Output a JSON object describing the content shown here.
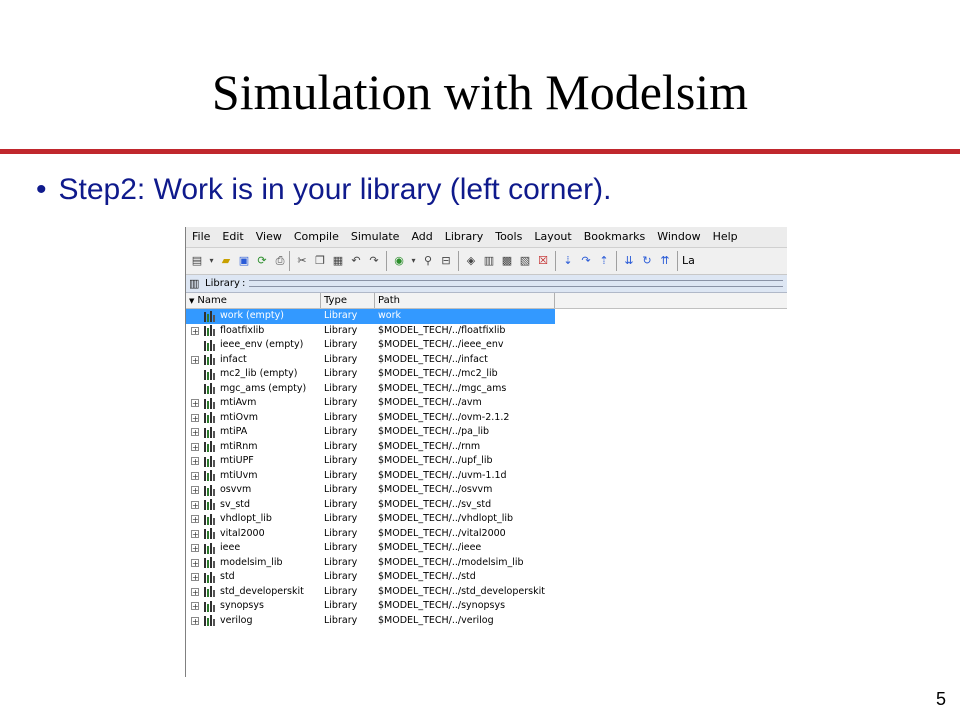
{
  "slide": {
    "title": "Simulation with Modelsim",
    "bullet": "Step2: Work is in your library (left corner).",
    "bullet_marker": "•",
    "page_number": "5",
    "accent_color": "#c0272d",
    "bullet_color": "#0f1a8c"
  },
  "app": {
    "menu": [
      "File",
      "Edit",
      "View",
      "Compile",
      "Simulate",
      "Add",
      "Library",
      "Tools",
      "Layout",
      "Bookmarks",
      "Window",
      "Help"
    ],
    "toolbar_cut_text": "La",
    "panel": {
      "title": "Library",
      "icon": "library-icon"
    },
    "columns": {
      "name": "Name",
      "type": "Type",
      "path": "Path"
    },
    "selection_color": "#3399ff",
    "libraries": [
      {
        "name": "work  (empty)",
        "type": "Library",
        "path": "work",
        "expandable": false,
        "selected": true
      },
      {
        "name": "floatfixlib",
        "type": "Library",
        "path": "$MODEL_TECH/../floatfixlib",
        "expandable": true
      },
      {
        "name": "ieee_env  (empty)",
        "type": "Library",
        "path": "$MODEL_TECH/../ieee_env",
        "expandable": false
      },
      {
        "name": "infact",
        "type": "Library",
        "path": "$MODEL_TECH/../infact",
        "expandable": true
      },
      {
        "name": "mc2_lib  (empty)",
        "type": "Library",
        "path": "$MODEL_TECH/../mc2_lib",
        "expandable": false
      },
      {
        "name": "mgc_ams  (empty)",
        "type": "Library",
        "path": "$MODEL_TECH/../mgc_ams",
        "expandable": false
      },
      {
        "name": "mtiAvm",
        "type": "Library",
        "path": "$MODEL_TECH/../avm",
        "expandable": true
      },
      {
        "name": "mtiOvm",
        "type": "Library",
        "path": "$MODEL_TECH/../ovm-2.1.2",
        "expandable": true
      },
      {
        "name": "mtiPA",
        "type": "Library",
        "path": "$MODEL_TECH/../pa_lib",
        "expandable": true
      },
      {
        "name": "mtiRnm",
        "type": "Library",
        "path": "$MODEL_TECH/../rnm",
        "expandable": true
      },
      {
        "name": "mtiUPF",
        "type": "Library",
        "path": "$MODEL_TECH/../upf_lib",
        "expandable": true
      },
      {
        "name": "mtiUvm",
        "type": "Library",
        "path": "$MODEL_TECH/../uvm-1.1d",
        "expandable": true
      },
      {
        "name": "osvvm",
        "type": "Library",
        "path": "$MODEL_TECH/../osvvm",
        "expandable": true
      },
      {
        "name": "sv_std",
        "type": "Library",
        "path": "$MODEL_TECH/../sv_std",
        "expandable": true
      },
      {
        "name": "vhdlopt_lib",
        "type": "Library",
        "path": "$MODEL_TECH/../vhdlopt_lib",
        "expandable": true
      },
      {
        "name": "vital2000",
        "type": "Library",
        "path": "$MODEL_TECH/../vital2000",
        "expandable": true
      },
      {
        "name": "ieee",
        "type": "Library",
        "path": "$MODEL_TECH/../ieee",
        "expandable": true
      },
      {
        "name": "modelsim_lib",
        "type": "Library",
        "path": "$MODEL_TECH/../modelsim_lib",
        "expandable": true
      },
      {
        "name": "std",
        "type": "Library",
        "path": "$MODEL_TECH/../std",
        "expandable": true
      },
      {
        "name": "std_developerskit",
        "type": "Library",
        "path": "$MODEL_TECH/../std_developerskit",
        "expandable": true
      },
      {
        "name": "synopsys",
        "type": "Library",
        "path": "$MODEL_TECH/../synopsys",
        "expandable": true
      },
      {
        "name": "verilog",
        "type": "Library",
        "path": "$MODEL_TECH/../verilog",
        "expandable": true
      }
    ]
  }
}
